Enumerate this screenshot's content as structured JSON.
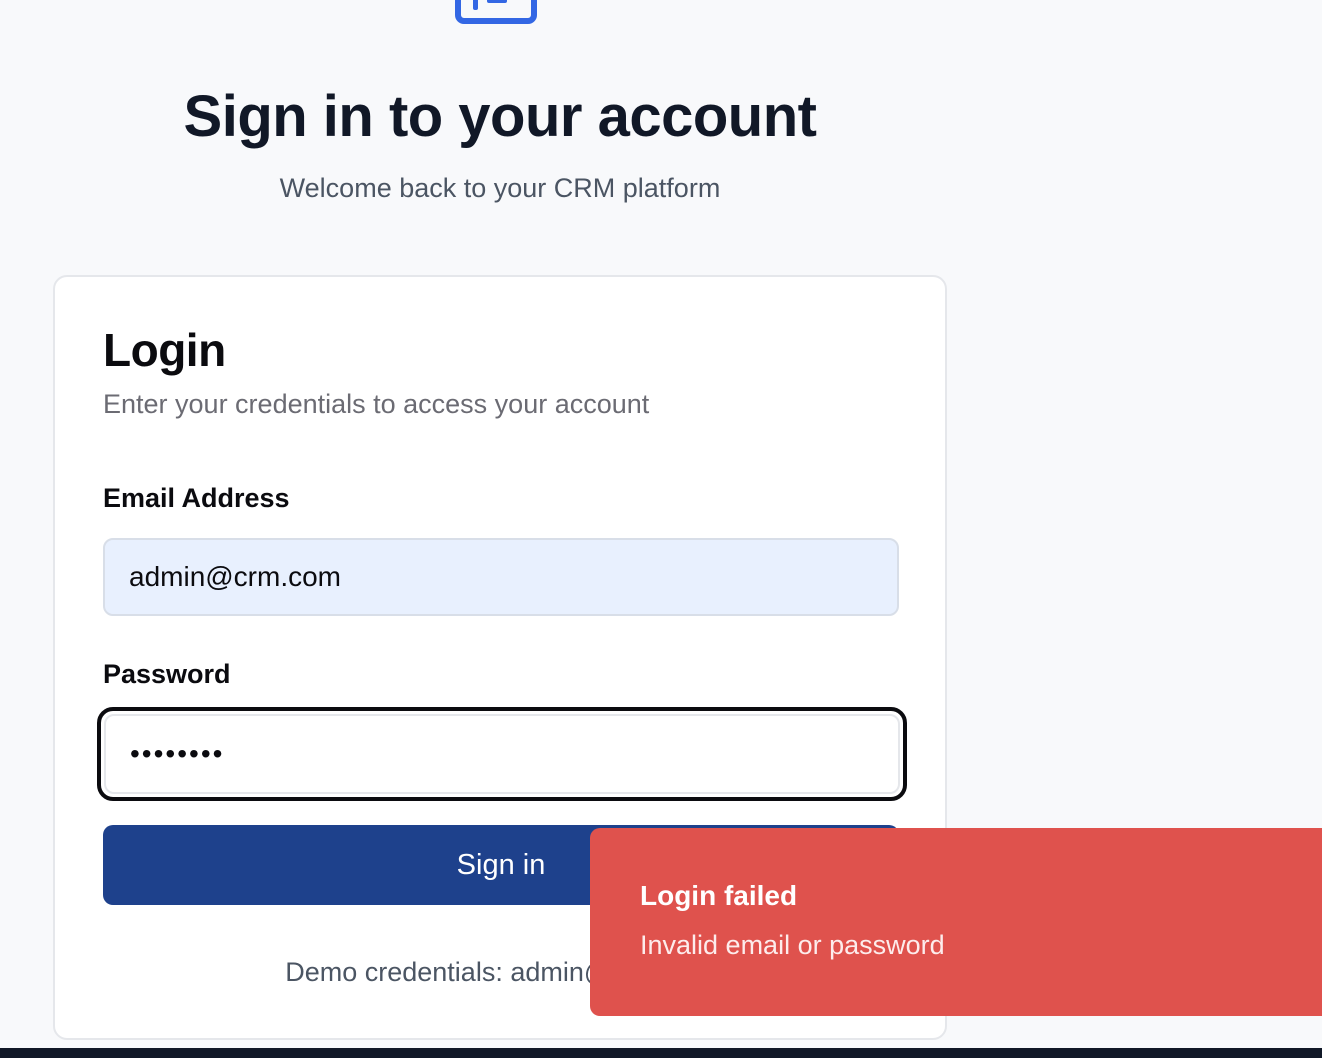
{
  "header": {
    "title": "Sign in to your account",
    "subtitle": "Welcome back to your CRM platform",
    "logo_icon": "id-card-icon",
    "accent_color": "#3367e4"
  },
  "login_card": {
    "title": "Login",
    "description": "Enter your credentials to access your account",
    "email": {
      "label": "Email Address",
      "value": "admin@crm.com"
    },
    "password": {
      "label": "Password",
      "value": "••••••••"
    },
    "submit_label": "Sign in",
    "submit_color": "#1e418c",
    "demo_text": "Demo credentials: admin@crm.com"
  },
  "toast": {
    "title": "Login failed",
    "message": "Invalid email or password",
    "color": "#df524d"
  }
}
